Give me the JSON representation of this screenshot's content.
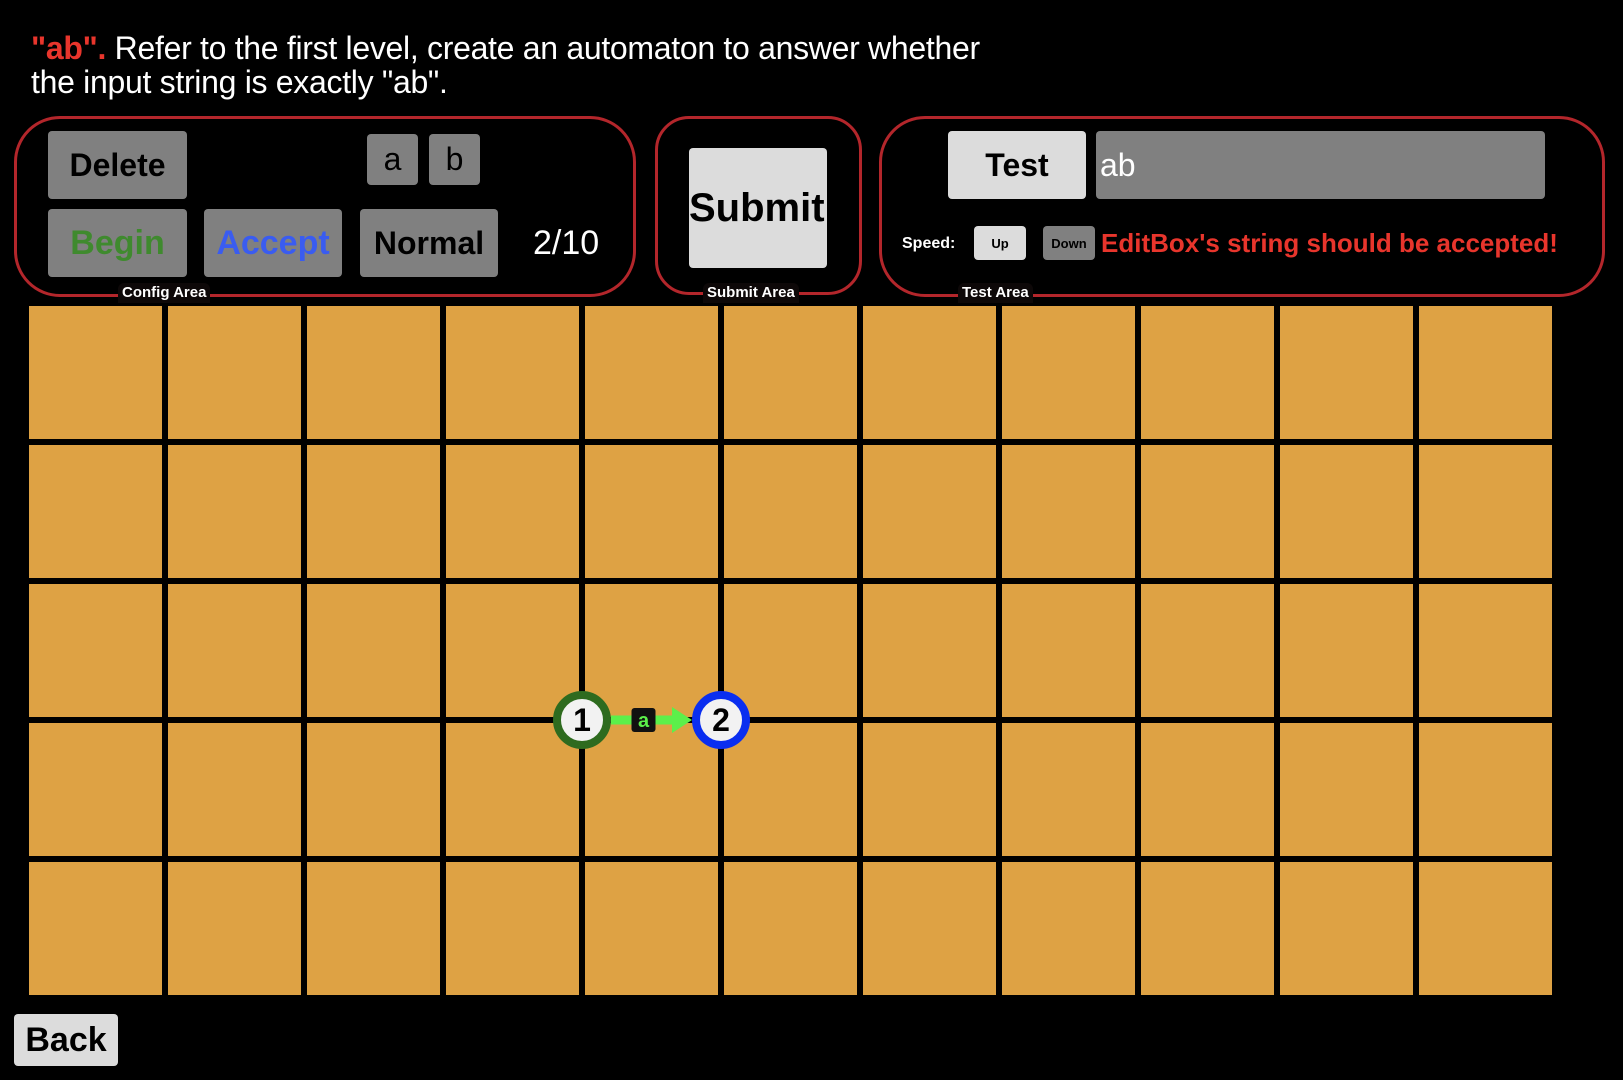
{
  "instructions": {
    "highlight": "\"ab\".",
    "text": " Refer to the first level, create an automaton to answer whether the input string is exactly \"ab\"."
  },
  "config_area": {
    "label": "Config Area",
    "delete_label": "Delete",
    "begin_label": "Begin",
    "accept_label": "Accept",
    "normal_label": "Normal",
    "symbols": [
      "a",
      "b"
    ],
    "counter": "2/10"
  },
  "submit_area": {
    "label": "Submit Area",
    "submit_label": "Submit"
  },
  "test_area": {
    "label": "Test Area",
    "test_label": "Test",
    "input_value": "ab",
    "speed_label": "Speed:",
    "up_label": "Up",
    "down_label": "Down",
    "status_message": "EditBox's string should be accepted!"
  },
  "grid": {
    "rows": 5,
    "cols": 11
  },
  "automaton": {
    "states": [
      {
        "id": "1",
        "type": "begin",
        "col": 3,
        "row": 2
      },
      {
        "id": "2",
        "type": "accept",
        "col": 4,
        "row": 2
      }
    ],
    "transitions": [
      {
        "from": "1",
        "to": "2",
        "symbol": "a"
      }
    ]
  },
  "colors": {
    "begin": "#2e6b1f",
    "accept": "#0a2ef0",
    "arrow": "#5cf04a",
    "cell": "#dea244",
    "area_border": "#b3262b",
    "status": "#e8352c"
  },
  "back_label": "Back"
}
